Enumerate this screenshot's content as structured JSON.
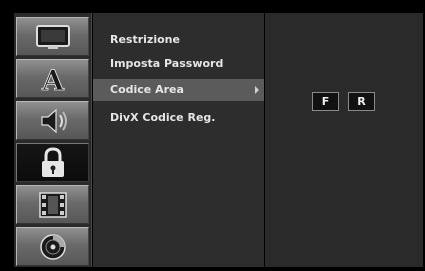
{
  "sidebar": {
    "icons": [
      {
        "name": "display-icon"
      },
      {
        "name": "language-icon",
        "glyph": "A"
      },
      {
        "name": "audio-icon"
      },
      {
        "name": "lock-icon"
      },
      {
        "name": "recording-icon"
      },
      {
        "name": "disc-icon"
      }
    ],
    "active_index": 3
  },
  "menu": {
    "items": [
      {
        "label": "Restrizione"
      },
      {
        "label": "Imposta Password"
      },
      {
        "label": "Codice Area"
      },
      {
        "label": "DivX Codice Reg."
      }
    ],
    "selected_index": 2
  },
  "area_code": {
    "chars": [
      "F",
      "R"
    ]
  },
  "colors": {
    "background": "#000000",
    "panel": "#2d2d2d",
    "selected_row": "#5b5b5b",
    "active_icon": "#111111"
  }
}
